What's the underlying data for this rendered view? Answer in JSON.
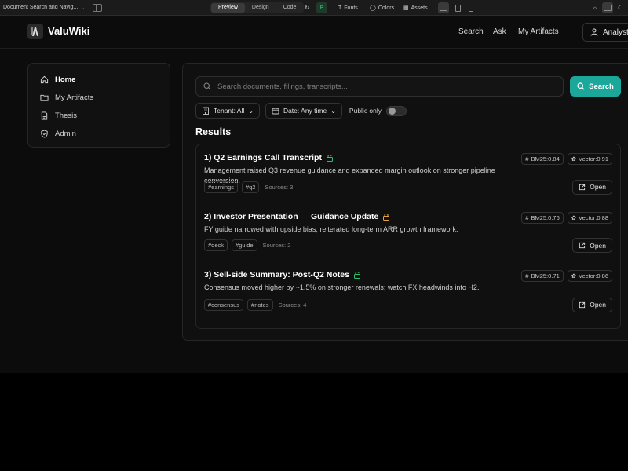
{
  "editor": {
    "title": "Document Search and Navig...",
    "tabs": [
      "Preview",
      "Design",
      "Code"
    ],
    "active_tab": "Preview",
    "fonts_label": "Fonts",
    "colors_label": "Colors",
    "assets_label": "Assets",
    "status_letter": "B"
  },
  "app": {
    "brand": "ValuWiki",
    "nav": {
      "search": "Search",
      "ask": "Ask",
      "artifacts": "My Artifacts"
    },
    "user": "Analyst"
  },
  "sidebar": {
    "items": [
      {
        "label": "Home",
        "icon": "home-icon",
        "active": true
      },
      {
        "label": "My Artifacts",
        "icon": "folder-icon",
        "active": false
      },
      {
        "label": "Thesis",
        "icon": "document-icon",
        "active": false
      },
      {
        "label": "Admin",
        "icon": "shield-icon",
        "active": false
      }
    ]
  },
  "search": {
    "placeholder": "Search documents, filings, transcripts...",
    "button": "Search",
    "filters": {
      "tenant": "Tenant: All",
      "date": "Date: Any time",
      "public_only": "Public only",
      "public_only_on": false
    }
  },
  "results": {
    "heading": "Results",
    "items": [
      {
        "title": "1) Q2 Earnings Call Transcript",
        "lock": "unlocked",
        "desc": "Management raised Q3 revenue guidance and expanded margin outlook on stronger pipeline conversion.",
        "tags": [
          "#earnings",
          "#q2"
        ],
        "sources": "Sources: 3",
        "bm25": "BM25:0.84",
        "vector": "Vector:0.91",
        "open": "Open"
      },
      {
        "title": "2) Investor Presentation — Guidance Update",
        "lock": "locked",
        "desc": "FY guide narrowed with upside bias; reiterated long-term ARR growth framework.",
        "tags": [
          "#deck",
          "#guide"
        ],
        "sources": "Sources: 2",
        "bm25": "BM25:0.76",
        "vector": "Vector:0.88",
        "open": "Open"
      },
      {
        "title": "3) Sell-side Summary: Post-Q2 Notes",
        "lock": "unlocked",
        "desc": "Consensus moved higher by ~1.5% on stronger renewals; watch FX headwinds into H2.",
        "tags": [
          "#consensus",
          "#notes"
        ],
        "sources": "Sources: 4",
        "bm25": "BM25:0.71",
        "vector": "Vector:0.86",
        "open": "Open"
      }
    ]
  },
  "colors": {
    "accent": "#1ba89a",
    "unlocked": "#2fbf71",
    "locked": "#e8a33a",
    "background": "#0c0c0c"
  }
}
